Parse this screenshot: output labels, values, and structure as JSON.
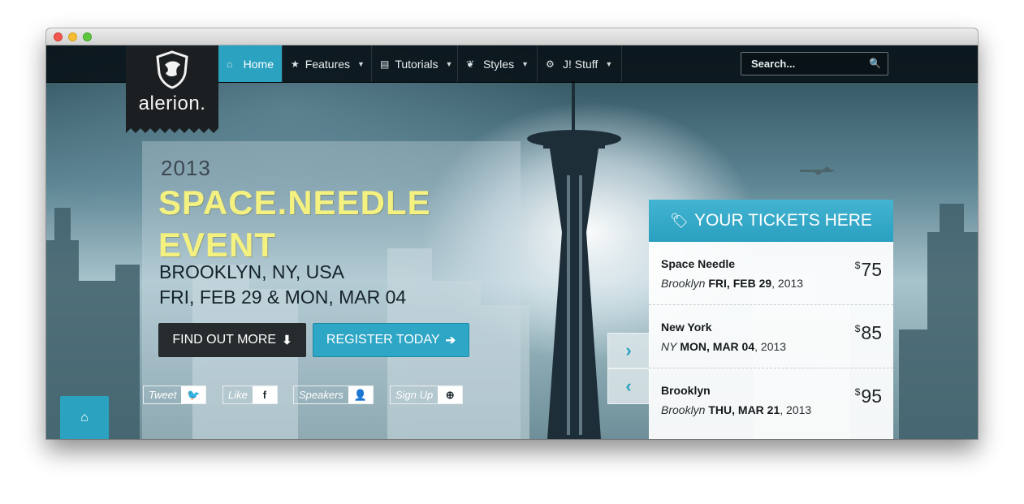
{
  "nav": {
    "items": [
      {
        "label": "Home",
        "icon": "home-icon",
        "active": true
      },
      {
        "label": "Features",
        "icon": "star-icon",
        "active": false
      },
      {
        "label": "Tutorials",
        "icon": "document-icon",
        "active": false
      },
      {
        "label": "Styles",
        "icon": "leaf-icon",
        "active": false
      },
      {
        "label": "J! Stuff",
        "icon": "cogs-icon",
        "active": false
      }
    ],
    "search_placeholder": "Search..."
  },
  "logo": {
    "text": "alerion."
  },
  "hero": {
    "year": "2013",
    "headline_line1": "SPACE.NEEDLE",
    "headline_line2": "EVENT",
    "location": "BROOKLYN, NY, USA",
    "dates": "FRI, FEB 29 & MON, MAR 04",
    "find_out_more": "FIND OUT MORE",
    "register_today": "REGISTER TODAY"
  },
  "social": [
    {
      "label": "Tweet",
      "icon": "twitter-icon",
      "glyph": "🐦"
    },
    {
      "label": "Like",
      "icon": "facebook-icon",
      "glyph": "f"
    },
    {
      "label": "Speakers",
      "icon": "user-icon",
      "glyph": "👤"
    },
    {
      "label": "Sign Up",
      "icon": "plus-circle-icon",
      "glyph": "⊕"
    }
  ],
  "tickets": {
    "title": "YOUR TICKETS HERE",
    "items": [
      {
        "name": "Space Needle",
        "city": "Brooklyn",
        "date": "FRI, FEB 29",
        "year": ", 2013",
        "currency": "$",
        "price": "75"
      },
      {
        "name": "New York",
        "city": "NY",
        "date": "MON, MAR 04",
        "year": ", 2013",
        "currency": "$",
        "price": "85"
      },
      {
        "name": "Brooklyn",
        "city": "Brooklyn",
        "date": "THU, MAR 21",
        "year": ", 2013",
        "currency": "$",
        "price": "95"
      }
    ]
  },
  "colors": {
    "accent": "#2aa2c0",
    "headline": "#f4f180",
    "nav_bg": "#0a141a"
  }
}
